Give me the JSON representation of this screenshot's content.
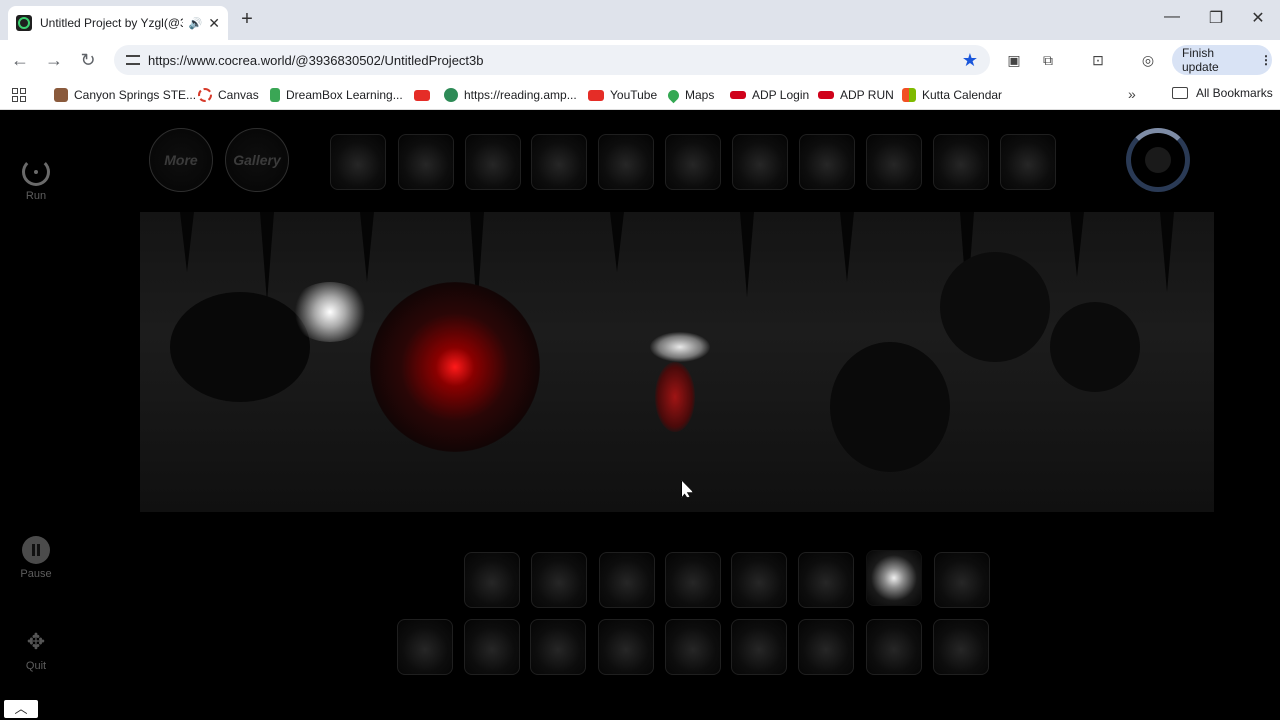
{
  "browser": {
    "tab_title": "Untitled Project by Yzgl(@3",
    "url": "https://www.cocrea.world/@3936830502/UntitledProject3b",
    "finish_update": "Finish update",
    "all_bookmarks": "All Bookmarks",
    "bookmarks": [
      {
        "label": "Canyon Springs STE...",
        "color": "#8a5a3c"
      },
      {
        "label": "Canvas",
        "color": "#d63a2a"
      },
      {
        "label": "DreamBox Learning...",
        "color": "#3aa655"
      },
      {
        "label": "",
        "color": "#e52d27"
      },
      {
        "label": "https://reading.amp...",
        "color": "#2e8b57"
      },
      {
        "label": "YouTube",
        "color": "#e52d27"
      },
      {
        "label": "Maps",
        "color": "#34a853"
      },
      {
        "label": "ADP Login",
        "color": "#d0021b"
      },
      {
        "label": "ADP RUN",
        "color": "#d0021b"
      },
      {
        "label": "Kutta Calendar",
        "color": "#f25022"
      }
    ]
  },
  "game": {
    "run_label": "Run",
    "pause_label": "Pause",
    "quit_label": "Quit",
    "more_label": "More",
    "gallery_label": "Gallery"
  }
}
